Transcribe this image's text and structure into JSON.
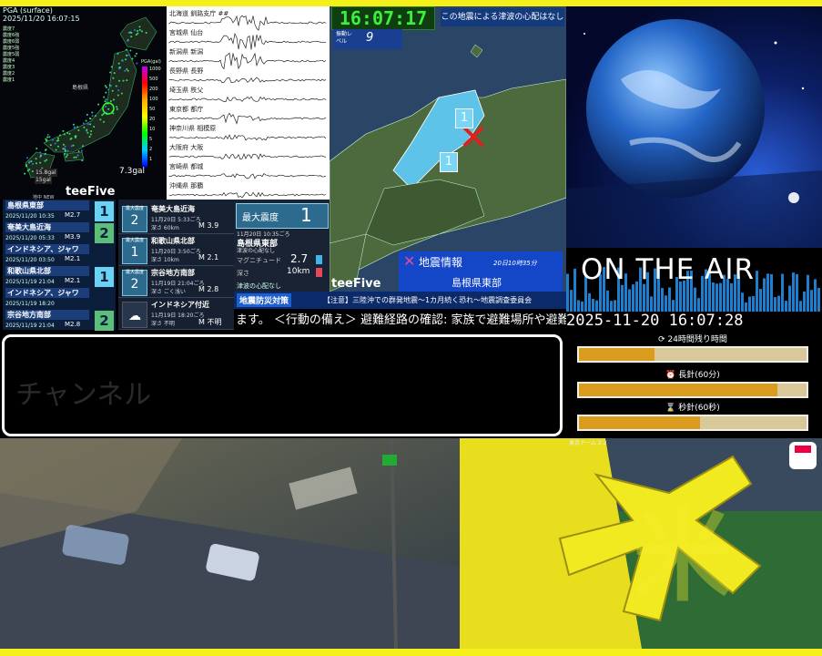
{
  "map_panel": {
    "header_line1": "PGA (surface)",
    "header_line2": "2025/11/20 16:07:15",
    "station_list": [
      "震度7",
      "震度6強",
      "震度6弱",
      "震度5強",
      "震度5弱",
      "震度4",
      "震度3",
      "震度2",
      "震度1"
    ],
    "pga_scale_label": "PGA(gal)",
    "pga_ticks": [
      "1000",
      "500",
      "200",
      "100",
      "50",
      "20",
      "10",
      "5",
      "2",
      "1"
    ],
    "max_pga": "7.3gal",
    "brand": "teeFive",
    "small_label": "地中 NEW",
    "map_note_1": "島根県",
    "map_note_2": "15gal",
    "callout": "15.8gal"
  },
  "wave_panel": {
    "stations": [
      "北海道 釧路支庁 ##",
      "宮城県 仙台",
      "新潟県 新潟",
      "長野県 長野",
      "埼玉県 秩父",
      "東京都 都庁",
      "神奈川県 相模原",
      "大阪府 大阪",
      "宮崎県 都城",
      "沖縄県 那覇"
    ]
  },
  "eq_list": [
    {
      "name": "島根県東部",
      "date": "2025/11/20 10:35",
      "mag": "M2.7",
      "intensity": "1",
      "int_bg": "#6ad2f2"
    },
    {
      "name": "奄美大島近海",
      "date": "2025/11/20 05:33",
      "mag": "M3.9",
      "intensity": "2",
      "int_bg": "#5bbf7a"
    },
    {
      "name": "インドネシア、ジャワ",
      "date": "2025/11/20 03:50",
      "mag": "M2.1",
      "intensity": "",
      "int_bg": ""
    },
    {
      "name": "和歌山県北部",
      "date": "2025/11/19 21:04",
      "mag": "M2.1",
      "intensity": "1",
      "int_bg": "#6ad2f2"
    },
    {
      "name": "インドネシア、ジャワ",
      "date": "2025/11/19 18:20",
      "mag": "",
      "intensity": "",
      "int_bg": ""
    },
    {
      "name": "宗谷地方南部",
      "date": "2025/11/19 21:04",
      "mag": "M2.8",
      "intensity": "2",
      "int_bg": "#5bbf7a"
    }
  ],
  "eq_cards": [
    {
      "badge_top": "最大震度",
      "badge": "2",
      "name": "奄美大島近海",
      "time": "11月20日 5:33ごろ",
      "sub": "深さ 60km",
      "mag": "M 3.9"
    },
    {
      "badge_top": "最大震度",
      "badge": "1",
      "name": "和歌山県北部",
      "time": "11月20日 3:50ごろ",
      "sub": "深さ 10km",
      "mag": "M 2.1"
    },
    {
      "badge_top": "最大震度",
      "badge": "2",
      "name": "宗谷地方南部",
      "time": "11月19日 21:04ごろ",
      "sub": "深さ ごく浅い",
      "mag": "M 2.8"
    },
    {
      "badge_top": "",
      "badge": "",
      "name": "インドネシア付近",
      "time": "11月19日 18:20ごろ",
      "sub": "深さ 不明",
      "mag": "M 不明"
    }
  ],
  "intensity_panel": {
    "label": "最大震度",
    "value": "1",
    "time": "11月20日 10:35ごろ",
    "region": "島根県東部",
    "note": "津波の心配なし",
    "mag_label": "マグニチュード",
    "mag_value": "2.7",
    "depth_label": "深さ",
    "depth_value": "10km",
    "tsunami": "津波の心配なし"
  },
  "region_map": {
    "clock": "16:07:17",
    "tsunami_msg": "この地震による津波の心配はなし",
    "level_label": "振動レベル",
    "level_value": "9",
    "brand": "teeFive",
    "marker_1": "1",
    "marker_2": "1",
    "alert_title": "地震情報",
    "alert_time": "20日10時35分",
    "alert_region": "島根県東部"
  },
  "info_bar": {
    "tag": "地震防災対策",
    "text": "【注意】三陸沖での群発地震〜1カ月続く恐れ〜地震調査委員会"
  },
  "ticker": {
    "text": "ます。 ＜行動の備え＞ 避難経路の確認: 家族で避難場所や避難経路"
  },
  "channel": {
    "label": "チャンネル"
  },
  "onair": {
    "title": "ON THE AIR",
    "datetime": "2025-11-20 16:07:28",
    "bars": [
      {
        "label": "24時間残り時間",
        "icon": "⟳",
        "fraction": 0.33
      },
      {
        "label": "長針(60分)",
        "icon": "⏰",
        "fraction": 0.87
      },
      {
        "label": "秒針(60秒)",
        "icon": "⌛",
        "fraction": 0.53
      }
    ]
  },
  "baseball": {
    "scoreboard": "東京ドーム 2-2",
    "big_text": "米"
  },
  "colors": {
    "frame": "#f5ef1a",
    "accent_blue": "#123a7c",
    "bar_fill": "#d99c1e"
  }
}
